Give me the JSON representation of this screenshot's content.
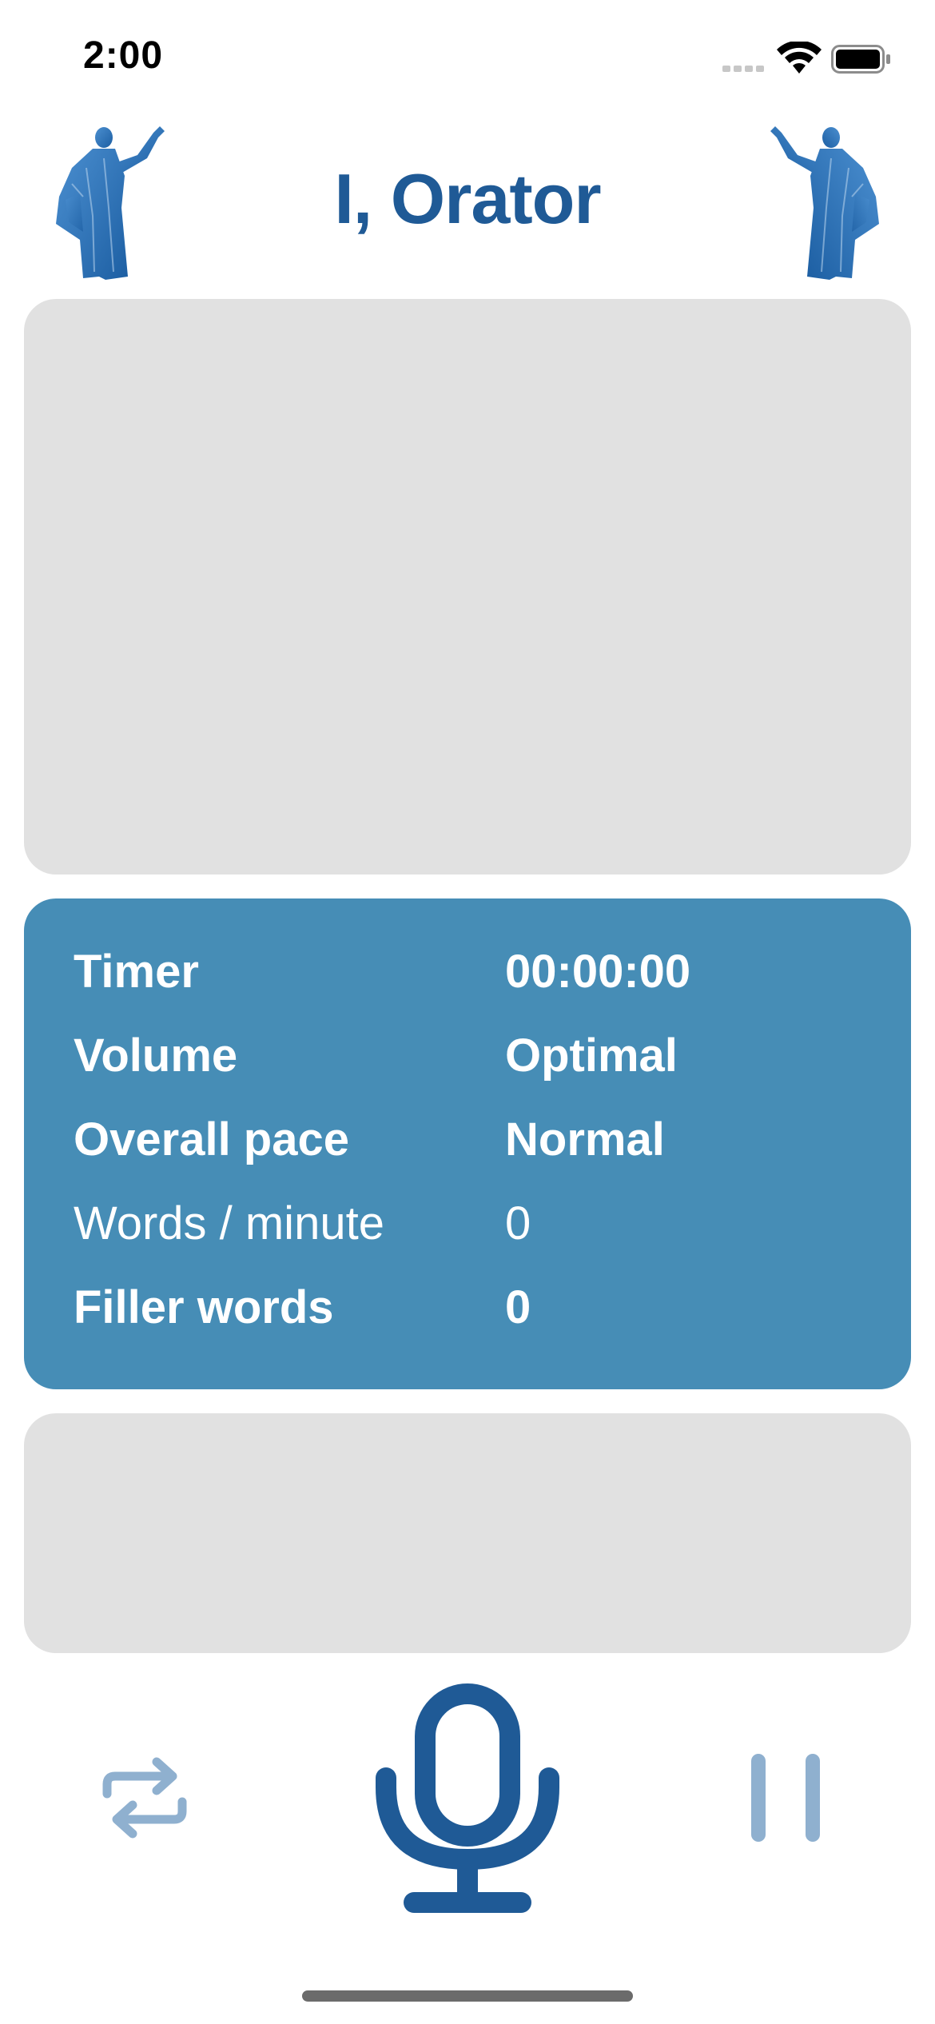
{
  "status_bar": {
    "time": "2:00"
  },
  "header": {
    "title": "I, Orator"
  },
  "stats": {
    "timer": {
      "label": "Timer",
      "value": "00:00:00"
    },
    "volume": {
      "label": "Volume",
      "value": "Optimal"
    },
    "pace": {
      "label": "Overall pace",
      "value": "Normal"
    },
    "wpm": {
      "label": "Words / minute",
      "value": "0"
    },
    "filler": {
      "label": "Filler words",
      "value": "0"
    }
  },
  "colors": {
    "brand": "#1f5a96",
    "stats_panel": "#468db6",
    "empty_panel": "#e1e1e1",
    "control_muted": "#8fb0cf"
  },
  "icons": {
    "statue": "orator-statue-icon",
    "repeat": "repeat-icon",
    "microphone": "microphone-icon",
    "pause": "pause-icon"
  }
}
